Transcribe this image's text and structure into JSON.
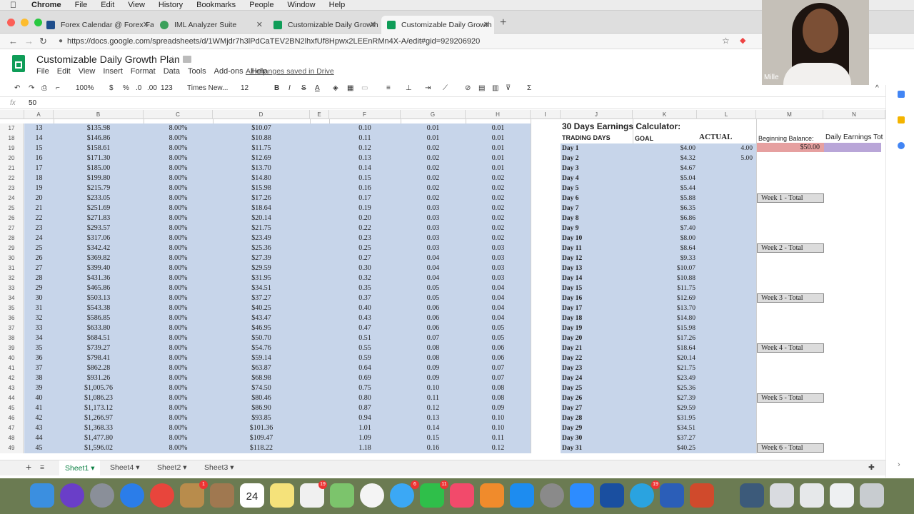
{
  "mac_menu": [
    "Chrome",
    "File",
    "Edit",
    "View",
    "History",
    "Bookmarks",
    "People",
    "Window",
    "Help"
  ],
  "tabs": [
    {
      "label": "Forex Calendar @ Forex Factor",
      "color": "#1f4e8c"
    },
    {
      "label": "IML Analyzer Suite",
      "color": "#3aa05a"
    },
    {
      "label": "Customizable Daily Growth Pla",
      "color": "#0f9d58"
    },
    {
      "label": "Customizable Daily Growth Pla",
      "color": "#0f9d58"
    }
  ],
  "url": "https://docs.google.com/spreadsheets/d/1WMjdr7h3lPdCaTEV2BN2lhxfUf8Hpwx2LEEnRMn4X-A/edit#gid=929206920",
  "doc": {
    "title": "Customizable Daily Growth Plan",
    "menu": [
      "File",
      "Edit",
      "View",
      "Insert",
      "Format",
      "Data",
      "Tools",
      "Add-ons",
      "Help"
    ],
    "saved": "All changes saved in Drive"
  },
  "toolbar": {
    "zoom": "100%",
    "currency": "$",
    "percent": "%",
    "dec_less": ".0",
    "dec_more": ".00",
    "more_formats": "123",
    "font": "Times New...",
    "size": "12",
    "bold": "B",
    "italic": "I",
    "strike": "S",
    "text_color": "A"
  },
  "formula": {
    "fx": "fx",
    "value": "50"
  },
  "columns": [
    "A",
    "B",
    "C",
    "D",
    "E",
    "F",
    "G",
    "H",
    "I",
    "J",
    "K",
    "L",
    "M",
    "N"
  ],
  "rows": [
    {
      "n": "17",
      "a": "13",
      "b": "$135.98",
      "c": "8.00%",
      "d": "$10.07",
      "f": "0.10",
      "g": "0.01",
      "h": "0.01"
    },
    {
      "n": "18",
      "a": "14",
      "b": "$146.86",
      "c": "8.00%",
      "d": "$10.88",
      "f": "0.11",
      "g": "0.01",
      "h": "0.01"
    },
    {
      "n": "19",
      "a": "15",
      "b": "$158.61",
      "c": "8.00%",
      "d": "$11.75",
      "f": "0.12",
      "g": "0.02",
      "h": "0.01"
    },
    {
      "n": "20",
      "a": "16",
      "b": "$171.30",
      "c": "8.00%",
      "d": "$12.69",
      "f": "0.13",
      "g": "0.02",
      "h": "0.01"
    },
    {
      "n": "21",
      "a": "17",
      "b": "$185.00",
      "c": "8.00%",
      "d": "$13.70",
      "f": "0.14",
      "g": "0.02",
      "h": "0.01"
    },
    {
      "n": "22",
      "a": "18",
      "b": "$199.80",
      "c": "8.00%",
      "d": "$14.80",
      "f": "0.15",
      "g": "0.02",
      "h": "0.02"
    },
    {
      "n": "23",
      "a": "19",
      "b": "$215.79",
      "c": "8.00%",
      "d": "$15.98",
      "f": "0.16",
      "g": "0.02",
      "h": "0.02"
    },
    {
      "n": "24",
      "a": "20",
      "b": "$233.05",
      "c": "8.00%",
      "d": "$17.26",
      "f": "0.17",
      "g": "0.02",
      "h": "0.02"
    },
    {
      "n": "25",
      "a": "21",
      "b": "$251.69",
      "c": "8.00%",
      "d": "$18.64",
      "f": "0.19",
      "g": "0.03",
      "h": "0.02"
    },
    {
      "n": "26",
      "a": "22",
      "b": "$271.83",
      "c": "8.00%",
      "d": "$20.14",
      "f": "0.20",
      "g": "0.03",
      "h": "0.02"
    },
    {
      "n": "27",
      "a": "23",
      "b": "$293.57",
      "c": "8.00%",
      "d": "$21.75",
      "f": "0.22",
      "g": "0.03",
      "h": "0.02"
    },
    {
      "n": "28",
      "a": "24",
      "b": "$317.06",
      "c": "8.00%",
      "d": "$23.49",
      "f": "0.23",
      "g": "0.03",
      "h": "0.02"
    },
    {
      "n": "29",
      "a": "25",
      "b": "$342.42",
      "c": "8.00%",
      "d": "$25.36",
      "f": "0.25",
      "g": "0.03",
      "h": "0.03"
    },
    {
      "n": "30",
      "a": "26",
      "b": "$369.82",
      "c": "8.00%",
      "d": "$27.39",
      "f": "0.27",
      "g": "0.04",
      "h": "0.03"
    },
    {
      "n": "31",
      "a": "27",
      "b": "$399.40",
      "c": "8.00%",
      "d": "$29.59",
      "f": "0.30",
      "g": "0.04",
      "h": "0.03"
    },
    {
      "n": "32",
      "a": "28",
      "b": "$431.36",
      "c": "8.00%",
      "d": "$31.95",
      "f": "0.32",
      "g": "0.04",
      "h": "0.03"
    },
    {
      "n": "33",
      "a": "29",
      "b": "$465.86",
      "c": "8.00%",
      "d": "$34.51",
      "f": "0.35",
      "g": "0.05",
      "h": "0.04"
    },
    {
      "n": "34",
      "a": "30",
      "b": "$503.13",
      "c": "8.00%",
      "d": "$37.27",
      "f": "0.37",
      "g": "0.05",
      "h": "0.04"
    },
    {
      "n": "35",
      "a": "31",
      "b": "$543.38",
      "c": "8.00%",
      "d": "$40.25",
      "f": "0.40",
      "g": "0.06",
      "h": "0.04"
    },
    {
      "n": "36",
      "a": "32",
      "b": "$586.85",
      "c": "8.00%",
      "d": "$43.47",
      "f": "0.43",
      "g": "0.06",
      "h": "0.04"
    },
    {
      "n": "37",
      "a": "33",
      "b": "$633.80",
      "c": "8.00%",
      "d": "$46.95",
      "f": "0.47",
      "g": "0.06",
      "h": "0.05"
    },
    {
      "n": "38",
      "a": "34",
      "b": "$684.51",
      "c": "8.00%",
      "d": "$50.70",
      "f": "0.51",
      "g": "0.07",
      "h": "0.05"
    },
    {
      "n": "39",
      "a": "35",
      "b": "$739.27",
      "c": "8.00%",
      "d": "$54.76",
      "f": "0.55",
      "g": "0.08",
      "h": "0.06"
    },
    {
      "n": "40",
      "a": "36",
      "b": "$798.41",
      "c": "8.00%",
      "d": "$59.14",
      "f": "0.59",
      "g": "0.08",
      "h": "0.06"
    },
    {
      "n": "41",
      "a": "37",
      "b": "$862.28",
      "c": "8.00%",
      "d": "$63.87",
      "f": "0.64",
      "g": "0.09",
      "h": "0.07"
    },
    {
      "n": "42",
      "a": "38",
      "b": "$931.26",
      "c": "8.00%",
      "d": "$68.98",
      "f": "0.69",
      "g": "0.09",
      "h": "0.07"
    },
    {
      "n": "43",
      "a": "39",
      "b": "$1,005.76",
      "c": "8.00%",
      "d": "$74.50",
      "f": "0.75",
      "g": "0.10",
      "h": "0.08"
    },
    {
      "n": "44",
      "a": "40",
      "b": "$1,086.23",
      "c": "8.00%",
      "d": "$80.46",
      "f": "0.80",
      "g": "0.11",
      "h": "0.08"
    },
    {
      "n": "45",
      "a": "41",
      "b": "$1,173.12",
      "c": "8.00%",
      "d": "$86.90",
      "f": "0.87",
      "g": "0.12",
      "h": "0.09"
    },
    {
      "n": "46",
      "a": "42",
      "b": "$1,266.97",
      "c": "8.00%",
      "d": "$93.85",
      "f": "0.94",
      "g": "0.13",
      "h": "0.10"
    },
    {
      "n": "47",
      "a": "43",
      "b": "$1,368.33",
      "c": "8.00%",
      "d": "$101.36",
      "f": "1.01",
      "g": "0.14",
      "h": "0.10"
    },
    {
      "n": "48",
      "a": "44",
      "b": "$1,477.80",
      "c": "8.00%",
      "d": "$109.47",
      "f": "1.09",
      "g": "0.15",
      "h": "0.11"
    },
    {
      "n": "49",
      "a": "45",
      "b": "$1,596.02",
      "c": "8.00%",
      "d": "$118.22",
      "f": "1.18",
      "g": "0.16",
      "h": "0.12"
    }
  ],
  "calculator": {
    "title": "30 Days Earnings Calculator:",
    "hdr_days": "TRADING DAYS",
    "hdr_goal": "GOAL",
    "hdr_actual": "ACTUAL",
    "beginning_label": "Beginning Balance:",
    "beginning_value": "$50.00",
    "daily_total_label": "Daily Earnings Tot",
    "days": [
      {
        "day": "Day 1",
        "goal": "$4.00",
        "actual": "4.00"
      },
      {
        "day": "Day 2",
        "goal": "$4.32",
        "actual": "5.00"
      },
      {
        "day": "Day 3",
        "goal": "$4.67",
        "actual": ""
      },
      {
        "day": "Day 4",
        "goal": "$5.04",
        "actual": ""
      },
      {
        "day": "Day 5",
        "goal": "$5.44",
        "actual": ""
      },
      {
        "day": "Day 6",
        "goal": "$5.88",
        "actual": ""
      },
      {
        "day": "Day 7",
        "goal": "$6.35",
        "actual": ""
      },
      {
        "day": "Day 8",
        "goal": "$6.86",
        "actual": ""
      },
      {
        "day": "Day 9",
        "goal": "$7.40",
        "actual": ""
      },
      {
        "day": "Day 10",
        "goal": "$8.00",
        "actual": ""
      },
      {
        "day": "Day 11",
        "goal": "$8.64",
        "actual": ""
      },
      {
        "day": "Day 12",
        "goal": "$9.33",
        "actual": ""
      },
      {
        "day": "Day 13",
        "goal": "$10.07",
        "actual": ""
      },
      {
        "day": "Day 14",
        "goal": "$10.88",
        "actual": ""
      },
      {
        "day": "Day 15",
        "goal": "$11.75",
        "actual": ""
      },
      {
        "day": "Day 16",
        "goal": "$12.69",
        "actual": ""
      },
      {
        "day": "Day 17",
        "goal": "$13.70",
        "actual": ""
      },
      {
        "day": "Day 18",
        "goal": "$14.80",
        "actual": ""
      },
      {
        "day": "Day 19",
        "goal": "$15.98",
        "actual": ""
      },
      {
        "day": "Day 20",
        "goal": "$17.26",
        "actual": ""
      },
      {
        "day": "Day 21",
        "goal": "$18.64",
        "actual": ""
      },
      {
        "day": "Day 22",
        "goal": "$20.14",
        "actual": ""
      },
      {
        "day": "Day 23",
        "goal": "$21.75",
        "actual": ""
      },
      {
        "day": "Day 24",
        "goal": "$23.49",
        "actual": ""
      },
      {
        "day": "Day 25",
        "goal": "$25.36",
        "actual": ""
      },
      {
        "day": "Day 26",
        "goal": "$27.39",
        "actual": ""
      },
      {
        "day": "Day 27",
        "goal": "$29.59",
        "actual": ""
      },
      {
        "day": "Day 28",
        "goal": "$31.95",
        "actual": ""
      },
      {
        "day": "Day 29",
        "goal": "$34.51",
        "actual": ""
      },
      {
        "day": "Day 30",
        "goal": "$37.27",
        "actual": ""
      },
      {
        "day": "Day 31",
        "goal": "$40.25",
        "actual": ""
      }
    ],
    "weeks": [
      {
        "label": "Week 1  - Total",
        "day_index": 5
      },
      {
        "label": "Week 2 - Total",
        "day_index": 10
      },
      {
        "label": "Week 3 - Total",
        "day_index": 15
      },
      {
        "label": "Week 4 - Total",
        "day_index": 20
      },
      {
        "label": "Week 5 - Total",
        "day_index": 25
      },
      {
        "label": "Week 6 - Total",
        "day_index": 30
      }
    ]
  },
  "sheets": [
    "Sheet1",
    "Sheet4",
    "Sheet2",
    "Sheet3"
  ],
  "webcam_name": "Mille",
  "dock_badges": {
    "calendar_day": "24",
    "b1": "1",
    "b2": "19",
    "b3": "6",
    "b4": "11",
    "b5": "19"
  }
}
